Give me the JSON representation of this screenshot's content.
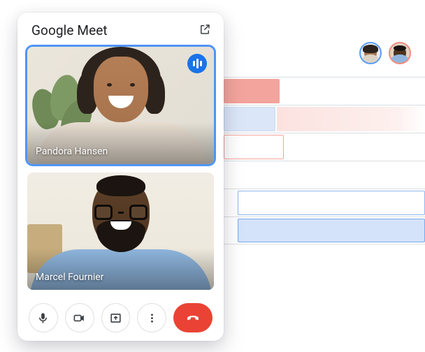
{
  "app": {
    "title": "Google Meet"
  },
  "participants": [
    {
      "name": "Pandora Hansen",
      "speaking": true,
      "active": true
    },
    {
      "name": "Marcel Fournier",
      "speaking": false,
      "active": false
    }
  ],
  "controls": {
    "mic": "microphone",
    "camera": "camera",
    "present": "present-screen",
    "more": "more-options",
    "hangup": "leave-call"
  },
  "icons": {
    "popout": "open-in-new"
  },
  "schedule": {
    "avatars": [
      "participant-1",
      "participant-2"
    ],
    "rows": 6
  }
}
